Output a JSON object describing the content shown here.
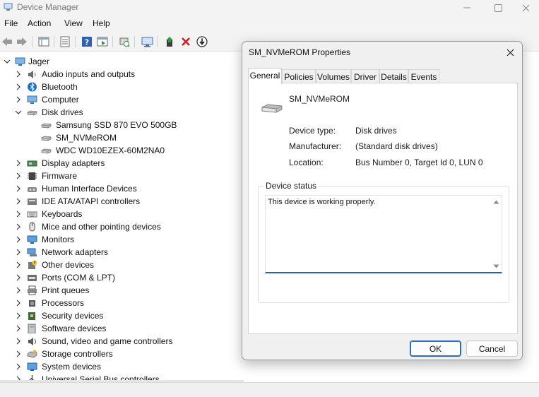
{
  "window": {
    "title": "Device Manager",
    "icon": "device-manager-icon",
    "controls": [
      "minimize-icon",
      "maximize-icon",
      "close-icon"
    ]
  },
  "menu": [
    "File",
    "Action",
    "View",
    "Help"
  ],
  "toolbar": [
    "back-icon",
    "forward-icon",
    "properties-sheet-icon",
    "driver-details-icon",
    "help-icon",
    "action-pane-icon",
    "scan-hardware-icon",
    "monitor-icon",
    "update-driver-icon",
    "uninstall-icon",
    "disable-device-icon"
  ],
  "tree": {
    "root": "Jager",
    "items": [
      {
        "label": "Audio inputs and outputs",
        "icon": "speaker-icon",
        "expanded": false
      },
      {
        "label": "Bluetooth",
        "icon": "bluetooth-icon",
        "expanded": false
      },
      {
        "label": "Computer",
        "icon": "computer-icon",
        "expanded": false
      },
      {
        "label": "Disk drives",
        "icon": "disk-drive-icon",
        "expanded": true
      },
      {
        "label": "Samsung SSD 870 EVO 500GB",
        "icon": "disk-drive-icon",
        "child": true
      },
      {
        "label": "SM_NVMeROM",
        "icon": "disk-drive-icon",
        "child": true
      },
      {
        "label": "WDC WD10EZEX-60M2NA0",
        "icon": "disk-drive-icon",
        "child": true
      },
      {
        "label": "Display adapters",
        "icon": "display-adapter-icon",
        "expanded": false
      },
      {
        "label": "Firmware",
        "icon": "firmware-icon",
        "expanded": false
      },
      {
        "label": "Human Interface Devices",
        "icon": "hid-icon",
        "expanded": false
      },
      {
        "label": "IDE ATA/ATAPI controllers",
        "icon": "ide-controller-icon",
        "expanded": false
      },
      {
        "label": "Keyboards",
        "icon": "keyboard-icon",
        "expanded": false
      },
      {
        "label": "Mice and other pointing devices",
        "icon": "mouse-icon",
        "expanded": false
      },
      {
        "label": "Monitors",
        "icon": "monitor-icon",
        "expanded": false
      },
      {
        "label": "Network adapters",
        "icon": "network-adapter-icon",
        "expanded": false
      },
      {
        "label": "Other devices",
        "icon": "other-devices-icon",
        "expanded": false
      },
      {
        "label": "Ports (COM & LPT)",
        "icon": "port-icon",
        "expanded": false
      },
      {
        "label": "Print queues",
        "icon": "printer-icon",
        "expanded": false
      },
      {
        "label": "Processors",
        "icon": "processor-icon",
        "expanded": false
      },
      {
        "label": "Security devices",
        "icon": "security-device-icon",
        "expanded": false
      },
      {
        "label": "Software devices",
        "icon": "software-device-icon",
        "expanded": false
      },
      {
        "label": "Sound, video and game controllers",
        "icon": "sound-icon",
        "expanded": false
      },
      {
        "label": "Storage controllers",
        "icon": "storage-controller-icon",
        "expanded": false
      },
      {
        "label": "System devices",
        "icon": "system-device-icon",
        "expanded": false
      },
      {
        "label": "Universal Serial Bus controllers",
        "icon": "usb-icon",
        "expanded": false
      }
    ]
  },
  "dialog": {
    "title": "SM_NVMeROM Properties",
    "tabs": [
      "General",
      "Policies",
      "Volumes",
      "Driver",
      "Details",
      "Events"
    ],
    "active_tab": "General",
    "device_name": "SM_NVMeROM",
    "properties": [
      {
        "label": "Device type:",
        "value": "Disk drives"
      },
      {
        "label": "Manufacturer:",
        "value": "(Standard disk drives)"
      },
      {
        "label": "Location:",
        "value": "Bus Number 0, Target Id 0, LUN 0"
      }
    ],
    "status_group_title": "Device status",
    "status_text": "This device is working properly.",
    "ok_label": "OK",
    "cancel_label": "Cancel"
  },
  "colors": {
    "accent": "#2b6cc0",
    "titlebar_bg": "#f3f3f3",
    "dialog_bg": "#f0f0f0"
  }
}
